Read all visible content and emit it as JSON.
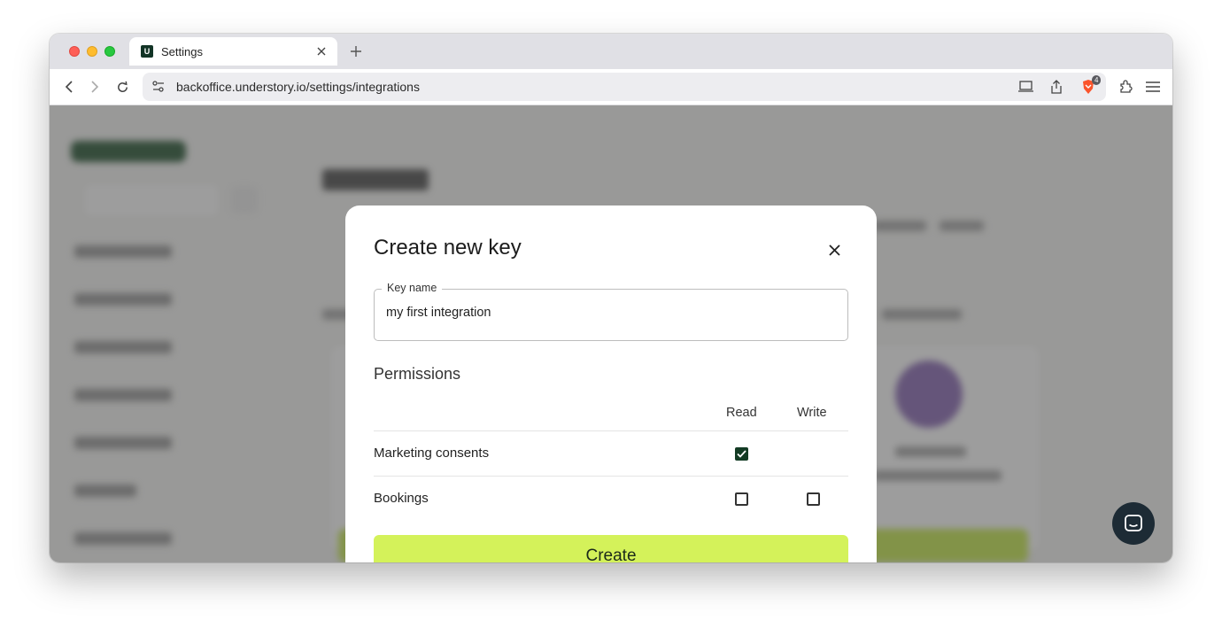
{
  "browser": {
    "tab_title": "Settings",
    "favicon_letter": "U",
    "url": "backoffice.understory.io/settings/integrations",
    "shields_count": "4"
  },
  "modal": {
    "title": "Create new key",
    "key_name_label": "Key name",
    "key_name_value": "my first integration",
    "permissions_title": "Permissions",
    "columns": [
      "Read",
      "Write"
    ],
    "rows": [
      {
        "label": "Marketing consents",
        "read": true,
        "write": null
      },
      {
        "label": "Bookings",
        "read": false,
        "write": false
      }
    ],
    "create_label": "Create"
  },
  "colors": {
    "accent": "#d4f25a",
    "checkbox_checked": "#133b24",
    "chat_bubble": "#1d2b35"
  }
}
